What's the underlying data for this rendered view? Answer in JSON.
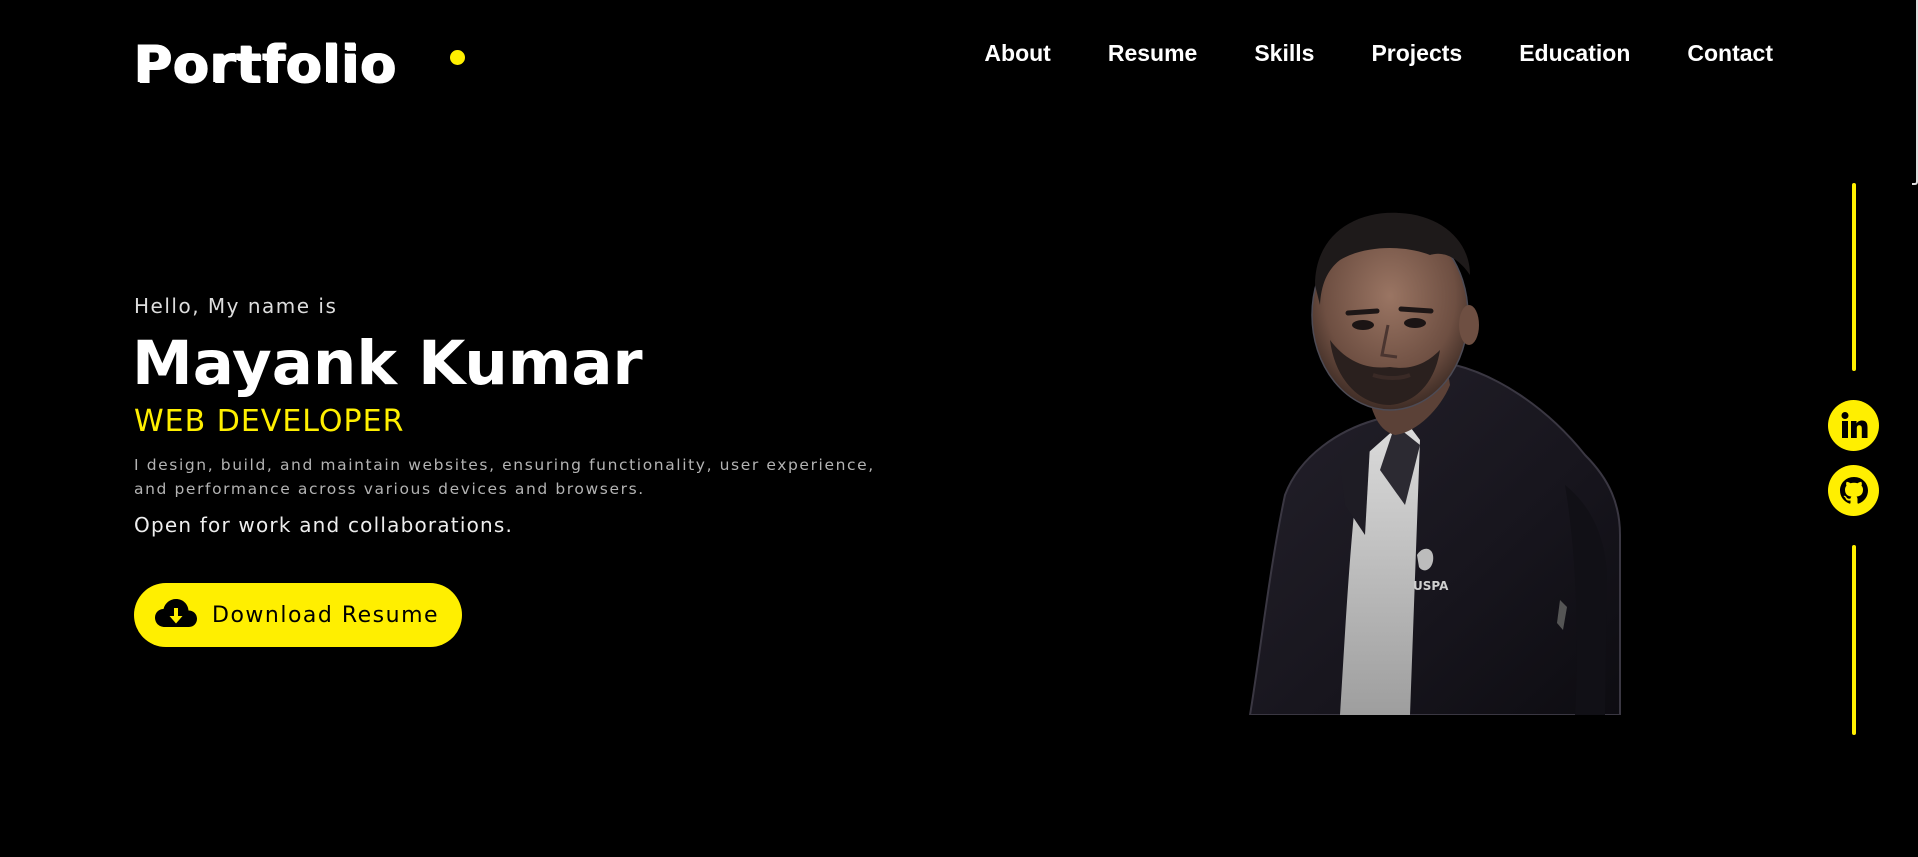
{
  "header": {
    "logo": "Portfolio",
    "nav": [
      "About",
      "Resume",
      "Skills",
      "Projects",
      "Education",
      "Contact"
    ]
  },
  "hero": {
    "greeting": "Hello, My name is",
    "name": "Mayank Kumar",
    "role": "WEB DEVELOPER",
    "description": "I design, build, and maintain websites, ensuring functionality, user experience, and performance across various devices and browsers.",
    "availability": "Open for work and collaborations.",
    "download_label": "Download Resume"
  },
  "portrait": {
    "shirt_text": "USPA"
  },
  "social": {
    "icons": [
      "linkedin-icon",
      "github-icon"
    ]
  },
  "colors": {
    "background": "#000000",
    "accent": "#ffef00",
    "text": "#ffffff",
    "muted": "#b3b3b3"
  }
}
